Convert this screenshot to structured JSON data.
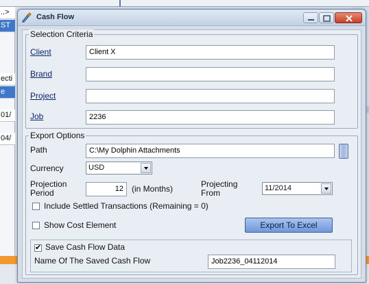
{
  "background": {
    "cells": [
      "..>",
      "ST",
      "ecti",
      "e",
      "01/",
      "04/"
    ]
  },
  "window": {
    "title": "Cash Flow",
    "icon": "cash-flow-app-icon"
  },
  "selection_criteria": {
    "legend": "Selection Criteria",
    "client_label": "Client",
    "client_value": "Client X",
    "brand_label": "Brand",
    "brand_value": "",
    "project_label": "Project",
    "project_value": "",
    "job_label": "Job",
    "job_value": "2236"
  },
  "export_options": {
    "legend": "Export Options",
    "path_label": "Path",
    "path_value": "C:\\My Dolphin Attachments",
    "currency_label": "Currency",
    "currency_value": "USD",
    "projection_period_label_1": "Projection",
    "projection_period_label_2": "Period",
    "projection_period_value": "12",
    "projection_unit": "(in Months)",
    "projecting_from_label_1": "Projecting",
    "projecting_from_label_2": "From",
    "projecting_from_value": "11/2014",
    "include_settled_label": "Include Settled Transactions (Remaining = 0)",
    "include_settled_checked": false,
    "show_cost_element_label": "Show Cost Element",
    "show_cost_element_checked": false,
    "export_button": "Export To Excel"
  },
  "save": {
    "save_label": "Save Cash Flow Data",
    "save_checked": true,
    "name_label": "Name Of The Saved Cash Flow",
    "name_value": "Job2236_04112014"
  },
  "colors": {
    "accent_orange": "#f29a2e",
    "close_button": "#c73f24",
    "export_button": "#7fa4e0"
  }
}
